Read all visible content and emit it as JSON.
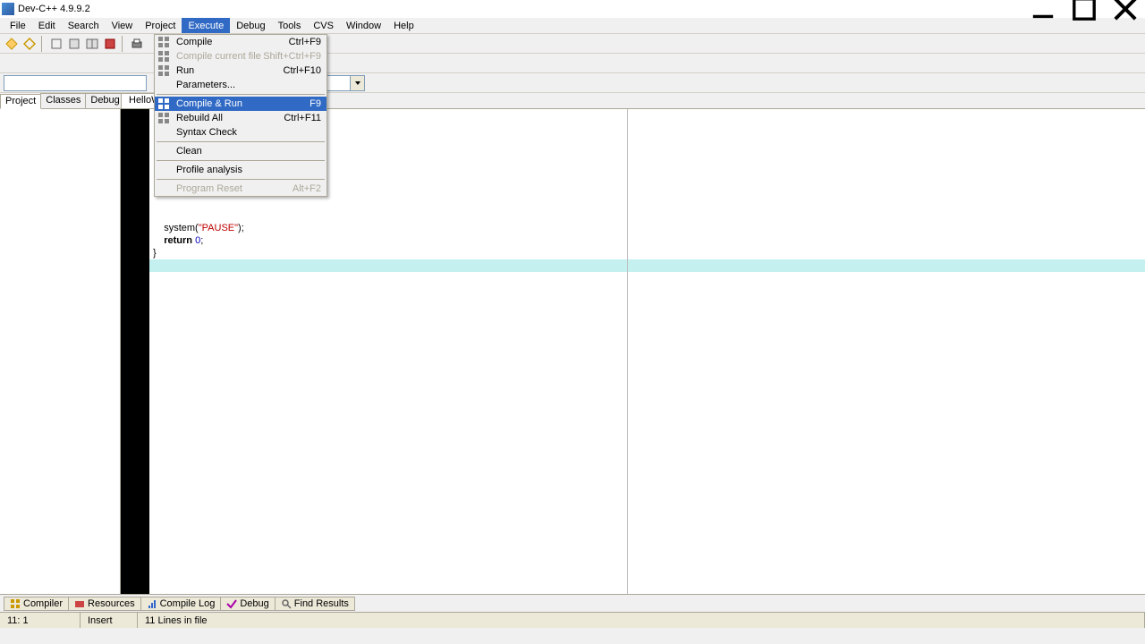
{
  "title": "Dev-C++ 4.9.9.2",
  "menus": [
    "File",
    "Edit",
    "Search",
    "View",
    "Project",
    "Execute",
    "Debug",
    "Tools",
    "CVS",
    "Window",
    "Help"
  ],
  "active_menu_index": 5,
  "sidebar_tabs": [
    "Project",
    "Classes",
    "Debug"
  ],
  "editor_tab": "HelloW",
  "dropdown": {
    "items": [
      {
        "label": "Compile",
        "accel": "Ctrl+F9",
        "disabled": false,
        "icon": "grid"
      },
      {
        "label": "Compile current file",
        "accel": "Shift+Ctrl+F9",
        "disabled": true,
        "icon": "grid"
      },
      {
        "label": "Run",
        "accel": "Ctrl+F10",
        "disabled": false,
        "icon": "box"
      },
      {
        "label": "Parameters...",
        "accel": "",
        "disabled": false,
        "icon": ""
      },
      {
        "sep": true
      },
      {
        "label": "Compile & Run",
        "accel": "F9",
        "disabled": false,
        "icon": "grid",
        "highlight": true
      },
      {
        "label": "Rebuild All",
        "accel": "Ctrl+F11",
        "disabled": false,
        "icon": "grid"
      },
      {
        "label": "Syntax Check",
        "accel": "",
        "disabled": false,
        "icon": ""
      },
      {
        "sep": true
      },
      {
        "label": "Clean",
        "accel": "",
        "disabled": false,
        "icon": ""
      },
      {
        "sep": true
      },
      {
        "label": "Profile analysis",
        "accel": "",
        "disabled": false,
        "icon": ""
      },
      {
        "sep": true
      },
      {
        "label": "Program Reset",
        "accel": "Alt+F2",
        "disabled": true,
        "icon": ""
      }
    ]
  },
  "code_lines": [
    {
      "text": "    system(\"PAUSE\");",
      "tokens": [
        {
          "t": "    system(",
          "c": "plain"
        },
        {
          "t": "\"PAUSE\"",
          "c": "str"
        },
        {
          "t": ");",
          "c": "plain"
        }
      ]
    },
    {
      "text": "    return 0;",
      "tokens": [
        {
          "t": "    ",
          "c": "plain"
        },
        {
          "t": "return",
          "c": "kw"
        },
        {
          "t": " ",
          "c": "plain"
        },
        {
          "t": "0",
          "c": "num"
        },
        {
          "t": ";",
          "c": "plain"
        }
      ]
    },
    {
      "text": "}",
      "tokens": [
        {
          "t": "}",
          "c": "plain"
        }
      ]
    }
  ],
  "bottom_tabs": [
    "Compiler",
    "Resources",
    "Compile Log",
    "Debug",
    "Find Results"
  ],
  "status": {
    "pos": "11: 1",
    "mode": "Insert",
    "info": "11 Lines in file"
  }
}
